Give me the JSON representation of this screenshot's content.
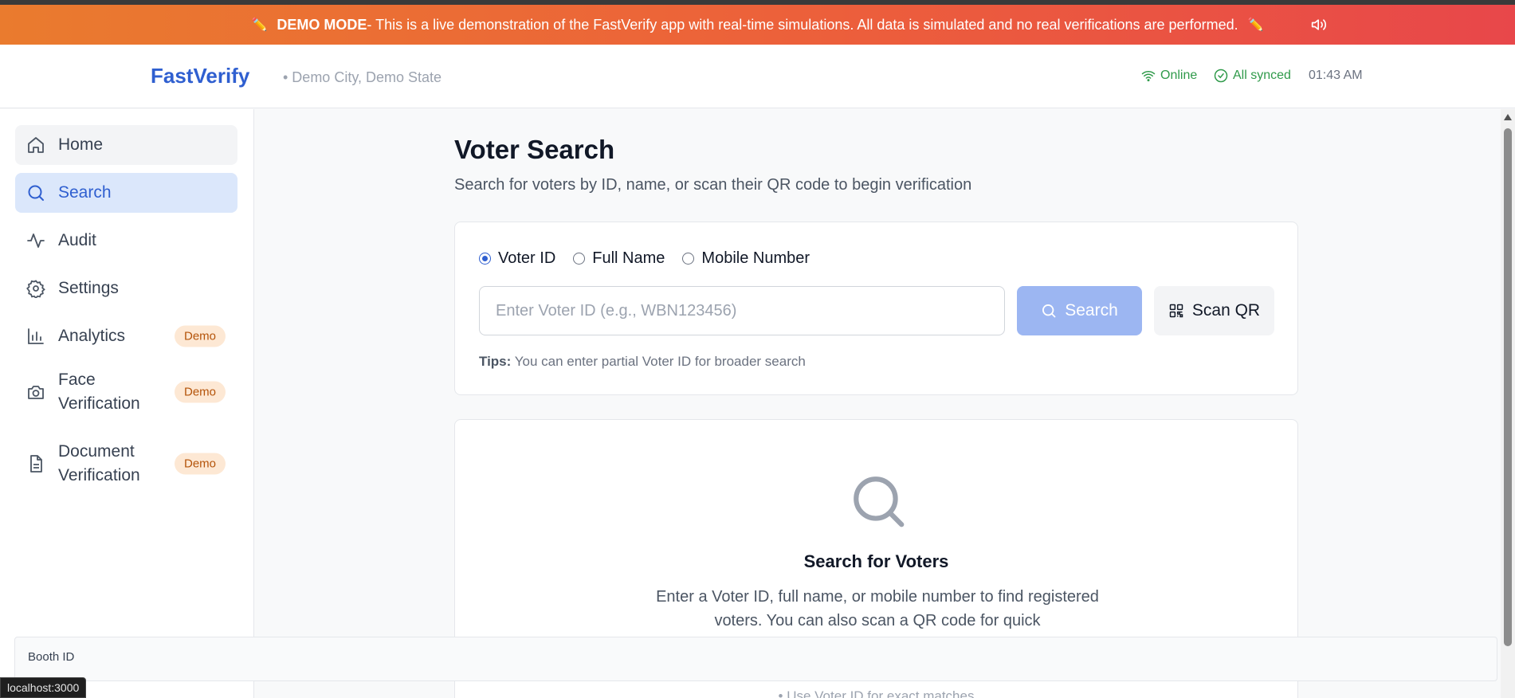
{
  "banner": {
    "mode_label": "DEMO MODE",
    "message": " - This is a live demonstration of the FastVerify app with real-time simulations. All data is simulated and no real verifications are performed.",
    "left_icon": "✏️",
    "right_icon": "✏️"
  },
  "header": {
    "brand": "FastVerify",
    "location": "• Demo City, Demo State",
    "online": "Online",
    "synced": "All synced",
    "time": "01:43 AM"
  },
  "sidebar": {
    "items": [
      {
        "label": "Home",
        "icon": "home-icon"
      },
      {
        "label": "Search",
        "icon": "search-icon"
      },
      {
        "label": "Audit",
        "icon": "activity-icon"
      },
      {
        "label": "Settings",
        "icon": "gear-icon"
      },
      {
        "label": "Analytics",
        "icon": "bar-chart-icon",
        "badge": "Demo"
      },
      {
        "label": "Face Verification",
        "icon": "camera-icon",
        "badge": "Demo"
      },
      {
        "label": "Document Verification",
        "icon": "document-icon",
        "badge": "Demo"
      }
    ]
  },
  "main": {
    "title": "Voter Search",
    "subtitle": "Search for voters by ID, name, or scan their QR code to begin verification",
    "search_modes": [
      "Voter ID",
      "Full Name",
      "Mobile Number"
    ],
    "selected_mode": "Voter ID",
    "input_placeholder": "Enter Voter ID (e.g., WBN123456)",
    "input_value": "",
    "search_button": "Search",
    "qr_button": "Scan QR",
    "tips_label": "Tips:",
    "tips_text": " You can enter partial Voter ID for broader search",
    "empty_title": "Search for Voters",
    "empty_desc": "Enter a Voter ID, full name, or mobile number to find registered voters. You can also scan a QR code for quick",
    "empty_bullet": "• Use Voter ID for exact matches"
  },
  "footer": {
    "booth_label": "Booth ID",
    "status_url": "localhost:3000"
  },
  "colors": {
    "accent": "#2f5fd0",
    "banner_start": "#ea7b2e",
    "banner_end": "#e8474a",
    "online_green": "#2f9a4a",
    "badge_bg": "#fde8d4"
  }
}
